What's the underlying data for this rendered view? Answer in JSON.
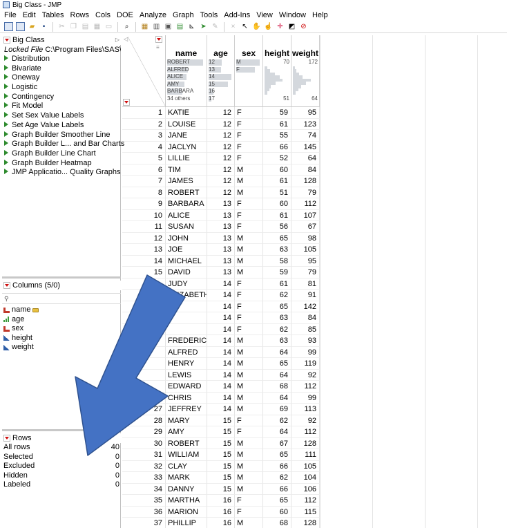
{
  "window": {
    "title": "Big Class - JMP"
  },
  "menu": [
    "File",
    "Edit",
    "Tables",
    "Rows",
    "Cols",
    "DOE",
    "Analyze",
    "Graph",
    "Tools",
    "Add-Ins",
    "View",
    "Window",
    "Help"
  ],
  "tables_panel": {
    "title": "Big Class",
    "locked_label": "Locked File",
    "locked_path": "C:\\Program Files\\SAS\\J",
    "scripts": [
      "Distribution",
      "Bivariate",
      "Oneway",
      "Logistic",
      "Contingency",
      "Fit Model",
      "Set Sex Value Labels",
      "Set Age Value Labels",
      "Graph Builder Smoother Line",
      "Graph Builder L... and Bar Charts",
      "Graph Builder Line Chart",
      "Graph Builder Heatmap",
      "JMP Applicatio... Quality Graphs"
    ]
  },
  "columns_panel": {
    "title": "Columns (5/0)",
    "search_icon": "magnifier-icon",
    "columns": [
      {
        "name": "name",
        "type": "nominal",
        "locked": true
      },
      {
        "name": "age",
        "type": "ordinal"
      },
      {
        "name": "sex",
        "type": "nominal"
      },
      {
        "name": "height",
        "type": "continuous"
      },
      {
        "name": "weight",
        "type": "continuous"
      }
    ]
  },
  "rows_panel": {
    "title": "Rows",
    "stats": [
      {
        "label": "All rows",
        "value": "40"
      },
      {
        "label": "Selected",
        "value": "0"
      },
      {
        "label": "Excluded",
        "value": "0"
      },
      {
        "label": "Hidden",
        "value": "0"
      },
      {
        "label": "Labeled",
        "value": "0"
      }
    ]
  },
  "grid": {
    "headers": [
      "name",
      "age",
      "sex",
      "height",
      "weight"
    ],
    "summary": {
      "name": [
        "ROBERT",
        "ALFRED",
        "ALICE",
        "AMY",
        "BARBARA",
        "34 others"
      ],
      "name_bars": [
        0.95,
        0.55,
        0.5,
        0.45,
        0.4,
        0
      ],
      "age": [
        "12",
        "13",
        "14",
        "15",
        "16",
        "17"
      ],
      "age_bars": [
        0.55,
        0.5,
        0.95,
        0.8,
        0.2,
        0.1
      ],
      "sex": [
        "M",
        "F"
      ],
      "sex_bars": [
        0.95,
        0.75
      ],
      "height": {
        "max": "70",
        "min": "51",
        "bars": [
          0.15,
          0.3,
          0.55,
          0.8,
          0.95,
          0.6,
          0.35,
          0.25,
          0.15
        ]
      },
      "weight": {
        "max": "172",
        "min": "64",
        "bars": [
          0.1,
          0.2,
          0.35,
          0.5,
          0.95,
          0.7,
          0.45,
          0.3,
          0.15
        ]
      }
    },
    "rows": [
      [
        "1",
        "KATIE",
        "12",
        "F",
        "59",
        "95"
      ],
      [
        "2",
        "LOUISE",
        "12",
        "F",
        "61",
        "123"
      ],
      [
        "3",
        "JANE",
        "12",
        "F",
        "55",
        "74"
      ],
      [
        "4",
        "JACLYN",
        "12",
        "F",
        "66",
        "145"
      ],
      [
        "5",
        "LILLIE",
        "12",
        "F",
        "52",
        "64"
      ],
      [
        "6",
        "TIM",
        "12",
        "M",
        "60",
        "84"
      ],
      [
        "7",
        "JAMES",
        "12",
        "M",
        "61",
        "128"
      ],
      [
        "8",
        "ROBERT",
        "12",
        "M",
        "51",
        "79"
      ],
      [
        "9",
        "BARBARA",
        "13",
        "F",
        "60",
        "112"
      ],
      [
        "10",
        "ALICE",
        "13",
        "F",
        "61",
        "107"
      ],
      [
        "11",
        "SUSAN",
        "13",
        "F",
        "56",
        "67"
      ],
      [
        "12",
        "JOHN",
        "13",
        "M",
        "65",
        "98"
      ],
      [
        "13",
        "JOE",
        "13",
        "M",
        "63",
        "105"
      ],
      [
        "14",
        "MICHAEL",
        "13",
        "M",
        "58",
        "95"
      ],
      [
        "15",
        "DAVID",
        "13",
        "M",
        "59",
        "79"
      ],
      [
        "",
        "JUDY",
        "14",
        "F",
        "61",
        "81"
      ],
      [
        "",
        "ELIZABETH",
        "14",
        "F",
        "62",
        "91"
      ],
      [
        "",
        "",
        "14",
        "F",
        "65",
        "142"
      ],
      [
        "",
        "",
        "14",
        "F",
        "63",
        "84"
      ],
      [
        "",
        "",
        "14",
        "F",
        "62",
        "85"
      ],
      [
        "",
        "FREDERICK",
        "14",
        "M",
        "63",
        "93"
      ],
      [
        "",
        "ALFRED",
        "14",
        "M",
        "64",
        "99"
      ],
      [
        "",
        "HENRY",
        "14",
        "M",
        "65",
        "119"
      ],
      [
        "",
        "LEWIS",
        "14",
        "M",
        "64",
        "92"
      ],
      [
        "",
        "EDWARD",
        "14",
        "M",
        "68",
        "112"
      ],
      [
        "26",
        "CHRIS",
        "14",
        "M",
        "64",
        "99"
      ],
      [
        "27",
        "JEFFREY",
        "14",
        "M",
        "69",
        "113"
      ],
      [
        "28",
        "MARY",
        "15",
        "F",
        "62",
        "92"
      ],
      [
        "29",
        "AMY",
        "15",
        "F",
        "64",
        "112"
      ],
      [
        "30",
        "ROBERT",
        "15",
        "M",
        "67",
        "128"
      ],
      [
        "31",
        "WILLIAM",
        "15",
        "M",
        "65",
        "111"
      ],
      [
        "32",
        "CLAY",
        "15",
        "M",
        "66",
        "105"
      ],
      [
        "33",
        "MARK",
        "15",
        "M",
        "62",
        "104"
      ],
      [
        "34",
        "DANNY",
        "15",
        "M",
        "66",
        "106"
      ],
      [
        "35",
        "MARTHA",
        "16",
        "F",
        "65",
        "112"
      ],
      [
        "36",
        "MARION",
        "16",
        "F",
        "60",
        "115"
      ],
      [
        "37",
        "PHILLIP",
        "16",
        "M",
        "68",
        "128"
      ]
    ]
  },
  "overlay": {
    "arrow_color": "#4472c4",
    "arrow_icon": "arrow-down-left-icon"
  }
}
